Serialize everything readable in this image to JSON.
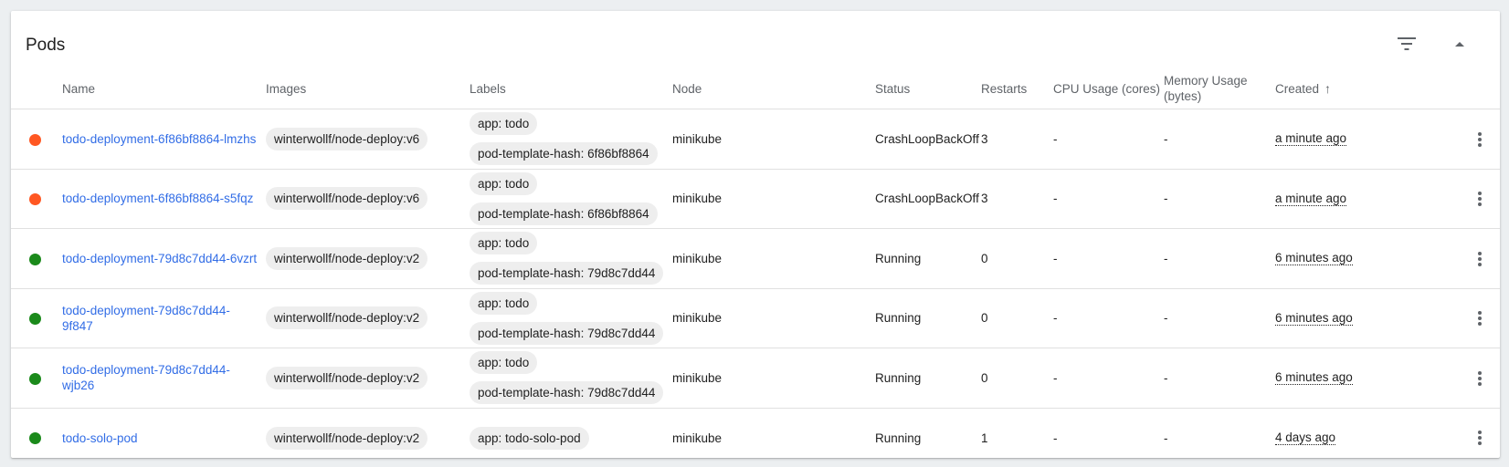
{
  "card": {
    "title": "Pods"
  },
  "columns": {
    "name": "Name",
    "images": "Images",
    "labels": "Labels",
    "node": "Node",
    "status": "Status",
    "restarts": "Restarts",
    "cpu": "CPU Usage (cores)",
    "memory_line1": "Memory Usage",
    "memory_line2": "(bytes)",
    "created": "Created"
  },
  "colors": {
    "error": "#ff5722",
    "running": "#1b8a1b",
    "link": "#326de6"
  },
  "pods": [
    {
      "status_color": "error",
      "name_lines": [
        "todo-deployment-6f86bf8864-lmzhs"
      ],
      "image": "winterwollf/node-deploy:v6",
      "labels": [
        "app: todo",
        "pod-template-hash: 6f86bf8864"
      ],
      "node": "minikube",
      "status": "CrashLoopBackOff",
      "restarts": "3",
      "cpu": "-",
      "memory": "-",
      "created": "a minute ago"
    },
    {
      "status_color": "error",
      "name_lines": [
        "todo-deployment-6f86bf8864-s5fqz"
      ],
      "image": "winterwollf/node-deploy:v6",
      "labels": [
        "app: todo",
        "pod-template-hash: 6f86bf8864"
      ],
      "node": "minikube",
      "status": "CrashLoopBackOff",
      "restarts": "3",
      "cpu": "-",
      "memory": "-",
      "created": "a minute ago"
    },
    {
      "status_color": "running",
      "name_lines": [
        "todo-deployment-79d8c7dd44-6vzrt"
      ],
      "image": "winterwollf/node-deploy:v2",
      "labels": [
        "app: todo",
        "pod-template-hash: 79d8c7dd44"
      ],
      "node": "minikube",
      "status": "Running",
      "restarts": "0",
      "cpu": "-",
      "memory": "-",
      "created": "6 minutes ago"
    },
    {
      "status_color": "running",
      "name_lines": [
        "todo-deployment-79d8c7dd44-",
        "9f847"
      ],
      "image": "winterwollf/node-deploy:v2",
      "labels": [
        "app: todo",
        "pod-template-hash: 79d8c7dd44"
      ],
      "node": "minikube",
      "status": "Running",
      "restarts": "0",
      "cpu": "-",
      "memory": "-",
      "created": "6 minutes ago"
    },
    {
      "status_color": "running",
      "name_lines": [
        "todo-deployment-79d8c7dd44-",
        "wjb26"
      ],
      "image": "winterwollf/node-deploy:v2",
      "labels": [
        "app: todo",
        "pod-template-hash: 79d8c7dd44"
      ],
      "node": "minikube",
      "status": "Running",
      "restarts": "0",
      "cpu": "-",
      "memory": "-",
      "created": "6 minutes ago"
    },
    {
      "status_color": "running",
      "name_lines": [
        "todo-solo-pod"
      ],
      "image": "winterwollf/node-deploy:v2",
      "labels": [
        "app: todo-solo-pod"
      ],
      "node": "minikube",
      "status": "Running",
      "restarts": "1",
      "cpu": "-",
      "memory": "-",
      "created": "4 days ago"
    }
  ]
}
